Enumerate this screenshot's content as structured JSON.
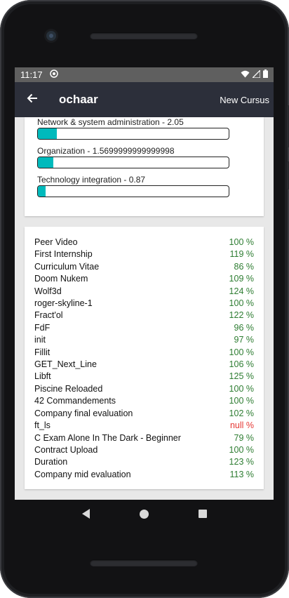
{
  "status": {
    "time": "11:17"
  },
  "app_bar": {
    "title": "ochaar",
    "action_label": "New Cursus"
  },
  "skills": [
    {
      "label": "Network & system administration - 2.05",
      "level": 0.1
    },
    {
      "label": "Organization - 1.5699999999999998",
      "level": 0.08
    },
    {
      "label": "Technology integration - 0.87",
      "level": 0.04
    }
  ],
  "projects": [
    {
      "name": "Peer Video",
      "value": "100 %",
      "status": "pass"
    },
    {
      "name": "First Internship",
      "value": "119 %",
      "status": "pass"
    },
    {
      "name": "Curriculum Vitae",
      "value": "86 %",
      "status": "pass"
    },
    {
      "name": "Doom Nukem",
      "value": "109 %",
      "status": "pass"
    },
    {
      "name": "Wolf3d",
      "value": "124 %",
      "status": "pass"
    },
    {
      "name": "roger-skyline-1",
      "value": "100 %",
      "status": "pass"
    },
    {
      "name": "Fract'ol",
      "value": "122 %",
      "status": "pass"
    },
    {
      "name": "FdF",
      "value": "96 %",
      "status": "pass"
    },
    {
      "name": "init",
      "value": "97 %",
      "status": "pass"
    },
    {
      "name": "Fillit",
      "value": "100 %",
      "status": "pass"
    },
    {
      "name": "GET_Next_Line",
      "value": "106 %",
      "status": "pass"
    },
    {
      "name": "Libft",
      "value": "125 %",
      "status": "pass"
    },
    {
      "name": "Piscine Reloaded",
      "value": "100 %",
      "status": "pass"
    },
    {
      "name": "42 Commandements",
      "value": "100 %",
      "status": "pass"
    },
    {
      "name": "Company final evaluation",
      "value": "102 %",
      "status": "pass"
    },
    {
      "name": "ft_ls",
      "value": "null %",
      "status": "fail"
    },
    {
      "name": "C Exam Alone In The Dark - Beginner",
      "value": "79 %",
      "status": "pass"
    },
    {
      "name": "Contract Upload",
      "value": "100 %",
      "status": "pass"
    },
    {
      "name": "Duration",
      "value": "123 %",
      "status": "pass"
    },
    {
      "name": "Company mid evaluation",
      "value": "113 %",
      "status": "pass"
    }
  ],
  "colors": {
    "accent": "#00babc",
    "pass": "#2e7d32",
    "fail": "#e53935",
    "app_bar": "#2c2f3a"
  }
}
